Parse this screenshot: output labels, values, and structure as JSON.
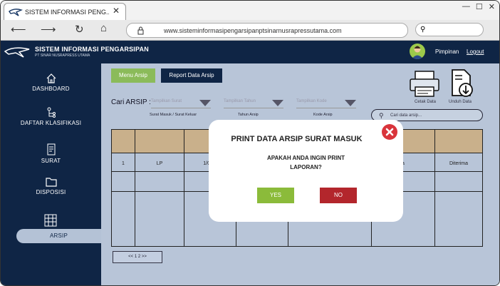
{
  "browser": {
    "tab_title": "SISTEM INFORMASI PENG...",
    "url": "www.sisteminformasipengarsipanptsinarnusrapressutama.com",
    "search_icon_name": "search-icon"
  },
  "header": {
    "app_name": "SISTEM INFORMASI PENGARSIPAN",
    "app_subtitle": "PT SINAR NUSRAPRESS UTAMA",
    "user_name": "Pimpinan",
    "logout_label": "Logout"
  },
  "sidebar": {
    "items": [
      {
        "label": "DASHBOARD",
        "icon": "home-icon"
      },
      {
        "label": "DAFTAR KLASIFIKASI",
        "icon": "hierarchy-icon"
      },
      {
        "label": "SURAT",
        "icon": "document-icon"
      },
      {
        "label": "DISPOSISI",
        "icon": "folder-icon"
      },
      {
        "label": "ARSIP",
        "icon": "archive-icon"
      }
    ],
    "active": "ARSIP"
  },
  "main": {
    "menu_arsip_label": "Menu Arsip",
    "report_label": "Report Data Arsip",
    "cari_label": "Cari ARSIP :",
    "filters": [
      {
        "placeholder": "Tampilkan Surat",
        "caption": "Surat Masuk / Surat Keluar"
      },
      {
        "placeholder": "Tampilkan Tahun",
        "caption": "Tahun Arsip"
      },
      {
        "placeholder": "Tampilkan Kode",
        "caption": "Kode Arsip"
      }
    ],
    "search_placeholder": "Cari data arsip...",
    "cetak_label": "Cetak Data",
    "unduh_label": "Unduh Data",
    "table": {
      "row1": {
        "no": "1",
        "kode": "LP",
        "tanggal": "1/08/2",
        "col5": "a",
        "status": "Diterima"
      }
    },
    "pager": "<< 1  2  >>"
  },
  "modal": {
    "title": "PRINT DATA ARSIP SURAT MASUK",
    "message_line1": "APAKAH ANDA INGIN PRINT",
    "message_line2": "LAPORAN?",
    "yes_label": "YES",
    "no_label": "NO"
  },
  "colors": {
    "navy": "#0f2545",
    "main_bg": "#b8c5d8",
    "green": "#8bbb5a",
    "red": "#b3262c",
    "table_header": "#c9b08b"
  }
}
